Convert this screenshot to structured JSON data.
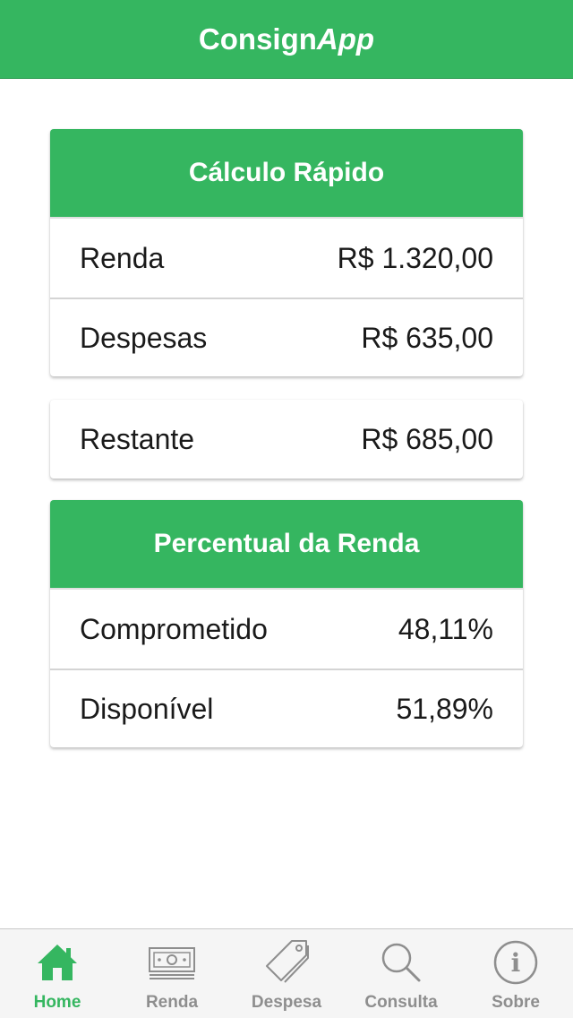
{
  "header": {
    "title_main": "Consign",
    "title_italic": "App"
  },
  "quick_calc": {
    "title": "Cálculo Rápido",
    "rows": [
      {
        "label": "Renda",
        "value": "R$ 1.320,00"
      },
      {
        "label": "Despesas",
        "value": "R$ 635,00"
      }
    ]
  },
  "remaining": {
    "label": "Restante",
    "value": "R$ 685,00"
  },
  "income_percent": {
    "title": "Percentual da Renda",
    "rows": [
      {
        "label": "Comprometido",
        "value": "48,11%"
      },
      {
        "label": "Disponível",
        "value": "51,89%"
      }
    ]
  },
  "tabs": [
    {
      "label": "Home",
      "icon": "home-icon",
      "active": true
    },
    {
      "label": "Renda",
      "icon": "banknote-icon",
      "active": false
    },
    {
      "label": "Despesa",
      "icon": "price-tag-icon",
      "active": false
    },
    {
      "label": "Consulta",
      "icon": "search-icon",
      "active": false
    },
    {
      "label": "Sobre",
      "icon": "info-icon",
      "active": false
    }
  ],
  "colors": {
    "accent": "#35b660",
    "tab_inactive": "#8e8e8e"
  }
}
